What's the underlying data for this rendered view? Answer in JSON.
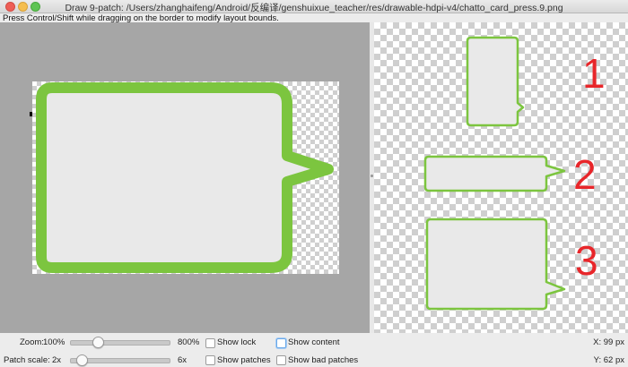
{
  "window": {
    "title": "Draw 9-patch: /Users/zhanghaifeng/Android/反编译/genshuixue_teacher/res/drawable-hdpi-v4/chatto_card_press.9.png",
    "hint": "Press Control/Shift while dragging on the border to modify layout bounds."
  },
  "preview": {
    "labels": [
      "1",
      "2",
      "3"
    ],
    "bubble_stroke": "#7cc53f",
    "bubble_fill": "#e9e9e9",
    "label_color": "#e8262a"
  },
  "controls": {
    "zoom": {
      "label": "Zoom:",
      "value": "100%",
      "max": "800%",
      "level": 0.04
    },
    "patch_scale": {
      "label": "Patch scale:",
      "value": "2x",
      "max": "6x",
      "level": 0.03
    },
    "checkboxes": {
      "show_lock": {
        "label": "Show lock",
        "checked": false
      },
      "show_content": {
        "label": "Show content",
        "checked": false
      },
      "show_patches": {
        "label": "Show patches",
        "checked": false
      },
      "show_bad_patches": {
        "label": "Show bad patches",
        "checked": false
      }
    },
    "coords": {
      "x": "X: 99 px",
      "y": "Y: 62 px"
    }
  }
}
